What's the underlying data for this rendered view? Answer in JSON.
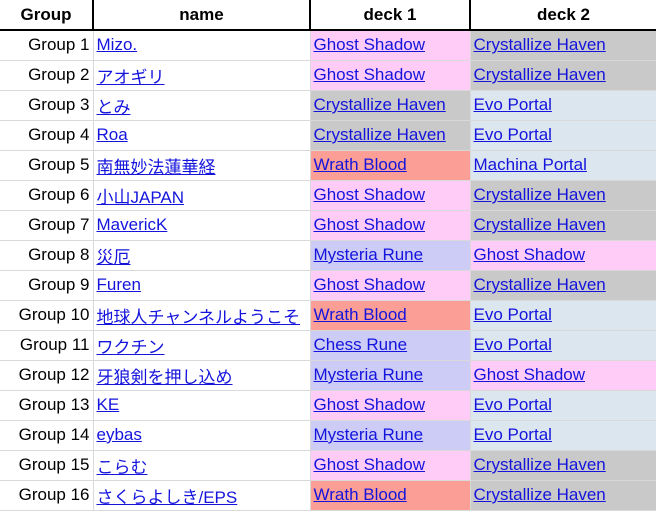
{
  "table": {
    "headers": [
      {
        "key": "group",
        "label": "Group"
      },
      {
        "key": "name",
        "label": "name"
      },
      {
        "key": "deck1",
        "label": "deck 1"
      },
      {
        "key": "deck2",
        "label": "deck 2"
      }
    ],
    "link_color": "#1414dd",
    "deck_colors": {
      "Ghost Shadow": "#ffccf7",
      "Crystallize Haven": "#c9c9c9",
      "Evo Portal": "#dce6ef",
      "Wrath Blood": "#fb9e96",
      "Machina Portal": "#dce6ef",
      "Mysteria Rune": "#ccccf7",
      "Chess Rune": "#ccccf7"
    },
    "rows": [
      {
        "group": "Group 1",
        "name": "Mizo.",
        "deck1": "Ghost Shadow",
        "deck2": "Crystallize Haven"
      },
      {
        "group": "Group 2",
        "name": "アオギリ",
        "deck1": "Ghost Shadow",
        "deck2": "Crystallize Haven"
      },
      {
        "group": "Group 3",
        "name": "とみ",
        "deck1": "Crystallize Haven",
        "deck2": "Evo Portal"
      },
      {
        "group": "Group 4",
        "name": "Roa",
        "deck1": "Crystallize Haven",
        "deck2": "Evo Portal"
      },
      {
        "group": "Group 5",
        "name": "南無妙法蓮華経",
        "deck1": "Wrath Blood",
        "deck2": "Machina Portal"
      },
      {
        "group": "Group 6",
        "name": "小山JAPAN",
        "deck1": "Ghost Shadow",
        "deck2": "Crystallize Haven"
      },
      {
        "group": "Group 7",
        "name": "MavericK",
        "deck1": "Ghost Shadow",
        "deck2": "Crystallize Haven"
      },
      {
        "group": "Group 8",
        "name": "災厄",
        "deck1": "Mysteria Rune",
        "deck2": "Ghost Shadow"
      },
      {
        "group": "Group 9",
        "name": "Furen",
        "deck1": "Ghost Shadow",
        "deck2": "Crystallize Haven"
      },
      {
        "group": "Group 10",
        "name": "地球人チャンネルようこそ",
        "deck1": "Wrath Blood",
        "deck2": "Evo Portal"
      },
      {
        "group": "Group 11",
        "name": "ワクチン",
        "deck1": "Chess Rune",
        "deck2": "Evo Portal"
      },
      {
        "group": "Group 12",
        "name": "牙狼剣を押し込め",
        "deck1": "Mysteria Rune",
        "deck2": "Ghost Shadow"
      },
      {
        "group": "Group 13",
        "name": "KE",
        "deck1": "Ghost Shadow",
        "deck2": "Evo Portal"
      },
      {
        "group": "Group 14",
        "name": "eybas",
        "deck1": "Mysteria Rune",
        "deck2": "Evo Portal"
      },
      {
        "group": "Group 15",
        "name": "こらむ",
        "deck1": "Ghost Shadow",
        "deck2": "Crystallize Haven"
      },
      {
        "group": "Group 16",
        "name": "さくらよしき/EPS",
        "deck1": "Wrath Blood",
        "deck2": "Crystallize Haven"
      }
    ]
  }
}
